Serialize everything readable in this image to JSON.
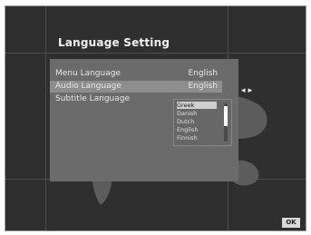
{
  "screen": {
    "title": "Language Setting"
  },
  "settings": [
    {
      "label": "Menu Language",
      "value": "English",
      "selected": false
    },
    {
      "label": "Audio Language",
      "value": "English",
      "selected": true
    },
    {
      "label": "Subtitle Language",
      "value": "",
      "selected": false
    }
  ],
  "dropdown": {
    "options": [
      "Greek",
      "Danish",
      "Dutch",
      "English",
      "Finnish"
    ],
    "selected_index": 0
  },
  "nav": {
    "arrows_text": "◂ ▸",
    "ok_label": "OK"
  },
  "colors": {
    "background": "#2f2f2f",
    "panel": "#6b6b6b",
    "highlight": "#8d8d8d"
  }
}
